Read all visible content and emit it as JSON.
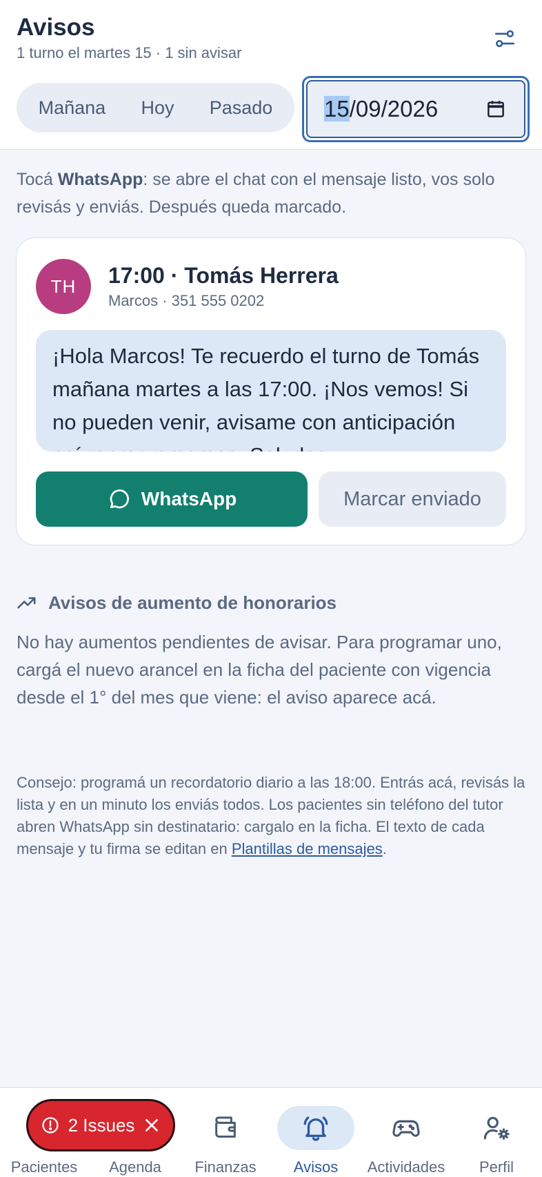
{
  "header": {
    "title": "Avisos",
    "subtitle": "1 turno el martes 15 · 1 sin avisar",
    "filter_icon": "sliders-icon"
  },
  "day_tabs": [
    "Mañana",
    "Hoy",
    "Pasado"
  ],
  "date_input": {
    "value_day_selected": "15",
    "value_rest": "/09/2026",
    "icon": "calendar-icon"
  },
  "intro": {
    "before": "Tocá ",
    "bold": "WhatsApp",
    "after": ": se abre el chat con el mensaje listo, vos solo revisás y enviás. Después queda marcado."
  },
  "reminder": {
    "initials": "TH",
    "title": "17:00 · Tomás Herrera",
    "subtitle": "Marcos · 351 555 0202",
    "message": "¡Hola Marcos! Te recuerdo el turno de Tomás mañana martes a las 17:00. ¡Nos vemos! Si no pueden venir, avisame con anticipación así reprogramamos. Saludos",
    "whatsapp_label": "WhatsApp",
    "mark_sent_label": "Marcar enviado",
    "avatar_color": "#b73d80",
    "whatsapp_color": "#127f6f"
  },
  "fees_section": {
    "icon": "trending-up-icon",
    "title": "Avisos de aumento de honorarios",
    "body": "No hay aumentos pendientes de avisar. Para programar uno, cargá el nuevo arancel en la ficha del paciente con vigencia desde el 1° del mes que viene: el aviso aparece acá."
  },
  "tip": {
    "text": "Consejo: programá un recordatorio diario a las 18:00. Entrás acá, revisás la lista y en un minuto los enviás todos. Los pacientes sin teléfono del tutor abren WhatsApp sin destinatario: cargalo en la ficha. El texto de cada mensaje y tu firma se editan en ",
    "link": "Plantillas de mensajes",
    "end": "."
  },
  "nav": [
    {
      "label": "Pacientes",
      "icon": "users-icon",
      "active": false
    },
    {
      "label": "Agenda",
      "icon": "calendar-icon",
      "active": false
    },
    {
      "label": "Finanzas",
      "icon": "wallet-icon",
      "active": false
    },
    {
      "label": "Avisos",
      "icon": "bell-icon",
      "active": true
    },
    {
      "label": "Actividades",
      "icon": "gamepad-icon",
      "active": false
    },
    {
      "label": "Perfil",
      "icon": "user-gear-icon",
      "active": false
    }
  ],
  "issues_badge": {
    "label": "2 Issues",
    "color": "#d7262e"
  },
  "colors": {
    "accent": "#2d5aa0",
    "background": "#f3f5fa"
  }
}
